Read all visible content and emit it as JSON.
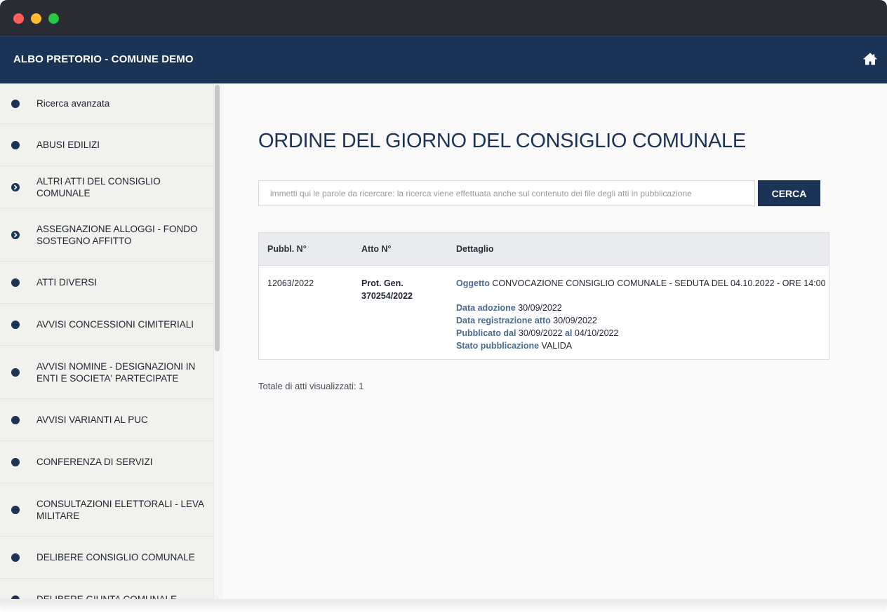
{
  "window": {
    "controls": [
      "close",
      "minimize",
      "maximize"
    ]
  },
  "header": {
    "title": "ALBO PRETORIO - COMUNE DEMO",
    "home_icon": "home-icon"
  },
  "sidebar": {
    "items": [
      {
        "label": "Ricerca avanzata",
        "icon": "dot",
        "height": 58
      },
      {
        "label": "ABUSI EDILIZI",
        "icon": "dot",
        "height": 60
      },
      {
        "label": "ALTRI ATTI DEL CONSIGLIO COMUNALE",
        "icon": "chevron",
        "height": 60
      },
      {
        "label": "ASSEGNAZIONE ALLOGGI - FONDO SOSTEGNO AFFITTO",
        "icon": "chevron",
        "height": 76
      },
      {
        "label": "ATTI DIVERSI",
        "icon": "dot",
        "height": 60
      },
      {
        "label": "AVVISI CONCESSIONI CIMITERIALI",
        "icon": "dot",
        "height": 60
      },
      {
        "label": "AVVISI NOMINE - DESIGNAZIONI IN ENTI E SOCIETA' PARTECIPATE",
        "icon": "dot",
        "height": 76
      },
      {
        "label": "AVVISI VARIANTI AL PUC",
        "icon": "dot",
        "height": 60
      },
      {
        "label": "CONFERENZA DI SERVIZI",
        "icon": "dot",
        "height": 60
      },
      {
        "label": "CONSULTAZIONI ELETTORALI - LEVA MILITARE",
        "icon": "dot",
        "height": 76
      },
      {
        "label": "DELIBERE CONSIGLIO COMUNALE",
        "icon": "dot",
        "height": 60
      },
      {
        "label": "DELIBERE GIUNTA COMUNALE",
        "icon": "dot",
        "height": 60
      }
    ]
  },
  "main": {
    "title": "ORDINE DEL GIORNO DEL CONSIGLIO COMUNALE",
    "search": {
      "placeholder": "immetti qui le parole da ricercare: la ricerca viene effettuata anche sul contenuto dei file degli atti in pubblicazione",
      "value": "",
      "button_label": "CERCA"
    },
    "table": {
      "columns": [
        "Pubbl. N°",
        "Atto N°",
        "Dettaglio"
      ],
      "rows": [
        {
          "pubbl_n": "12063/2022",
          "atto_n_line1": "Prot. Gen.",
          "atto_n_line2": "370254/2022",
          "oggetto_label": "Oggetto",
          "oggetto": "CONVOCAZIONE CONSIGLIO COMUNALE - SEDUTA DEL 04.10.2022 - ORE 14:00",
          "data_adozione_label": "Data adozione",
          "data_adozione": "30/09/2022",
          "data_registrazione_label": "Data registrazione atto",
          "data_registrazione": "30/09/2022",
          "pubblicato_dal_label": "Pubblicato dal",
          "pubblicato_dal": "30/09/2022",
          "pubblicato_al_label": "al",
          "pubblicato_al": "04/10/2022",
          "stato_label": "Stato pubblicazione",
          "stato": "VALIDA"
        }
      ]
    },
    "total": "Totale di atti visualizzati: 1"
  }
}
